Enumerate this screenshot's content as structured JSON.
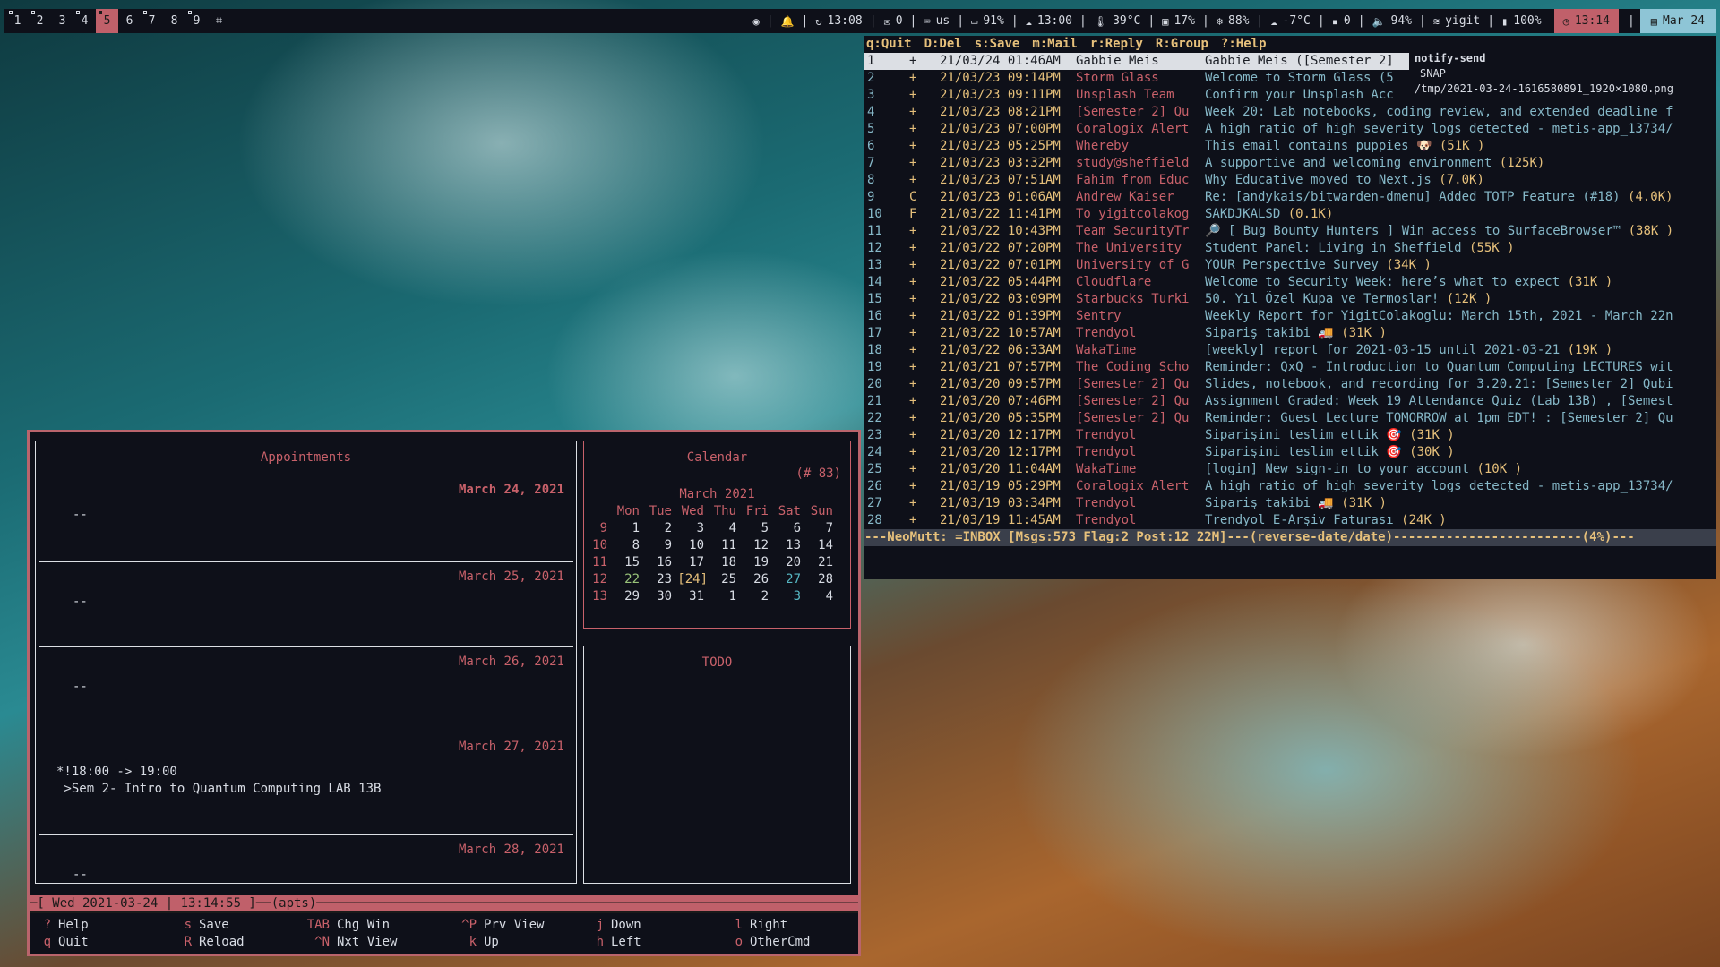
{
  "topbar": {
    "workspaces": [
      {
        "label": "1",
        "occupied": true
      },
      {
        "label": "2",
        "occupied": true
      },
      {
        "label": "3",
        "occupied": false
      },
      {
        "label": "4",
        "occupied": true
      },
      {
        "label": "5",
        "occupied": true,
        "active": true
      },
      {
        "label": "6",
        "occupied": false
      },
      {
        "label": "7",
        "occupied": true
      },
      {
        "label": "8",
        "occupied": false
      },
      {
        "label": "9",
        "occupied": true
      }
    ],
    "layout_icon": "layout-icon",
    "modules": [
      {
        "icon": "eye-icon",
        "glyph": "◉",
        "text": ""
      },
      {
        "icon": "bell-icon",
        "glyph": "🔔",
        "text": ""
      },
      {
        "icon": "refresh-icon",
        "glyph": "↻",
        "text": "13:08"
      },
      {
        "icon": "mail-icon",
        "glyph": "✉",
        "text": "0"
      },
      {
        "icon": "keyboard-icon",
        "glyph": "⌨",
        "text": "us"
      },
      {
        "icon": "laptop-icon",
        "glyph": "▭",
        "text": "91%"
      },
      {
        "icon": "cloud-upload-icon",
        "glyph": "☁",
        "text": "13:00"
      },
      {
        "icon": "thermometer-icon",
        "glyph": "🌡",
        "text": "39°C"
      },
      {
        "icon": "cpu-icon",
        "glyph": "▣",
        "text": "17%"
      },
      {
        "icon": "snowflake-icon",
        "glyph": "❄",
        "text": "88%"
      },
      {
        "icon": "weather-icon",
        "glyph": "☁",
        "text": "-7°C"
      },
      {
        "icon": "disk-icon",
        "glyph": "▪",
        "text": "0"
      },
      {
        "icon": "volume-icon",
        "glyph": "🔈",
        "text": "94%"
      },
      {
        "icon": "wifi-icon",
        "glyph": "≋",
        "text": "yigit"
      },
      {
        "icon": "battery-icon",
        "glyph": "▮",
        "text": "100%"
      }
    ],
    "clock": {
      "icon": "clock-icon",
      "glyph": "◷",
      "text": "13:14"
    },
    "date": {
      "icon": "calendar-icon",
      "glyph": "▤",
      "text": "Mar 24"
    }
  },
  "mutt": {
    "help": [
      "q:Quit",
      "D:Del",
      "s:Save",
      "m:Mail",
      "r:Reply",
      "R:Group",
      "?:Help"
    ],
    "rows": [
      {
        "n": "1",
        "f": "+",
        "d": "21/03/24 01:46AM",
        "s": "Gabbie Meis",
        "sub": "Gabbie Meis ([Semester 2]",
        "sz": ""
      },
      {
        "n": "2",
        "f": "+",
        "d": "21/03/23 09:14PM",
        "s": "Storm Glass",
        "sub": "Welcome to Storm Glass (5",
        "sz": ""
      },
      {
        "n": "3",
        "f": "+",
        "d": "21/03/23 09:11PM",
        "s": "Unsplash Team",
        "sub": "Confirm your Unsplash Acc",
        "sz": ""
      },
      {
        "n": "4",
        "f": "+",
        "d": "21/03/23 08:21PM",
        "s": "[Semester 2] Qu",
        "sub": "Week 20: Lab notebooks, coding review, and extended deadline f",
        "sz": ""
      },
      {
        "n": "5",
        "f": "+",
        "d": "21/03/23 07:00PM",
        "s": "Coralogix Alert",
        "sub": "A high ratio of high severity logs detected - metis-app_13734/",
        "sz": ""
      },
      {
        "n": "6",
        "f": "+",
        "d": "21/03/23 05:25PM",
        "s": "Whereby",
        "sub": "This email contains puppies 🐶 ",
        "sz": "(51K )"
      },
      {
        "n": "7",
        "f": "+",
        "d": "21/03/23 03:32PM",
        "s": "study@sheffield",
        "sub": "A supportive and welcoming environment ",
        "sz": "(125K)"
      },
      {
        "n": "8",
        "f": "+",
        "d": "21/03/23 07:51AM",
        "s": "Fahim from Educ",
        "sub": "Why Educative moved to Next.js ",
        "sz": "(7.0K)"
      },
      {
        "n": "9",
        "f": "C",
        "d": "21/03/23 01:06AM",
        "s": "Andrew Kaiser",
        "sub": "Re: [andykais/bitwarden-dmenu] Added TOTP Feature (#18) ",
        "sz": "(4.0K)"
      },
      {
        "n": "10",
        "f": "F",
        "d": "21/03/22 11:41PM",
        "s": "To yigitcolakog",
        "sub": "SAKDJKALSD ",
        "sz": "(0.1K)"
      },
      {
        "n": "11",
        "f": "+",
        "d": "21/03/22 10:43PM",
        "s": "Team SecurityTr",
        "sub": "🔎 [ Bug Bounty Hunters ] Win access to SurfaceBrowser™ ",
        "sz": "(38K )"
      },
      {
        "n": "12",
        "f": "+",
        "d": "21/03/22 07:20PM",
        "s": "The University",
        "sub": "Student Panel: Living in Sheffield ",
        "sz": "(55K )"
      },
      {
        "n": "13",
        "f": "+",
        "d": "21/03/22 07:01PM",
        "s": "University of G",
        "sub": "YOUR Perspective Survey ",
        "sz": "(34K )"
      },
      {
        "n": "14",
        "f": "+",
        "d": "21/03/22 05:44PM",
        "s": "Cloudflare",
        "sub": "Welcome to Security Week: here’s what to expect ",
        "sz": "(31K )"
      },
      {
        "n": "15",
        "f": "+",
        "d": "21/03/22 03:09PM",
        "s": "Starbucks Turki",
        "sub": "50. Yıl Özel Kupa ve Termoslar! ",
        "sz": "(12K )"
      },
      {
        "n": "16",
        "f": "+",
        "d": "21/03/22 01:39PM",
        "s": "Sentry",
        "sub": "Weekly Report for YigitColakoglu: March 15th, 2021 - March 22n",
        "sz": ""
      },
      {
        "n": "17",
        "f": "+",
        "d": "21/03/22 10:57AM",
        "s": "Trendyol",
        "sub": "Sipariş takibi 🚚 ",
        "sz": "(31K )"
      },
      {
        "n": "18",
        "f": "+",
        "d": "21/03/22 06:33AM",
        "s": "WakaTime",
        "sub": "[weekly] report for 2021-03-15 until 2021-03-21 ",
        "sz": "(19K )"
      },
      {
        "n": "19",
        "f": "+",
        "d": "21/03/21 07:57PM",
        "s": "The Coding Scho",
        "sub": "Reminder: QxQ - Introduction to Quantum Computing LECTURES wit",
        "sz": ""
      },
      {
        "n": "20",
        "f": "+",
        "d": "21/03/20 09:57PM",
        "s": "[Semester 2] Qu",
        "sub": "Slides, notebook, and recording for 3.20.21: [Semester 2] Qubi",
        "sz": ""
      },
      {
        "n": "21",
        "f": "+",
        "d": "21/03/20 07:46PM",
        "s": "[Semester 2] Qu",
        "sub": "Assignment Graded: Week 19 Attendance Quiz (Lab 13B) , [Semest",
        "sz": ""
      },
      {
        "n": "22",
        "f": "+",
        "d": "21/03/20 05:35PM",
        "s": "[Semester 2] Qu",
        "sub": "Reminder: Guest Lecture TOMORROW at 1pm EDT! : [Semester 2] Qu",
        "sz": ""
      },
      {
        "n": "23",
        "f": "+",
        "d": "21/03/20 12:17PM",
        "s": "Trendyol",
        "sub": "Siparişini teslim ettik 🎯 ",
        "sz": "(31K )"
      },
      {
        "n": "24",
        "f": "+",
        "d": "21/03/20 12:17PM",
        "s": "Trendyol",
        "sub": "Siparişini teslim ettik 🎯 ",
        "sz": "(30K )"
      },
      {
        "n": "25",
        "f": "+",
        "d": "21/03/20 11:04AM",
        "s": "WakaTime",
        "sub": "[login] New sign-in to your account ",
        "sz": "(10K )"
      },
      {
        "n": "26",
        "f": "+",
        "d": "21/03/19 05:29PM",
        "s": "Coralogix Alert",
        "sub": "A high ratio of high severity logs detected - metis-app_13734/",
        "sz": ""
      },
      {
        "n": "27",
        "f": "+",
        "d": "21/03/19 03:34PM",
        "s": "Trendyol",
        "sub": "Sipariş takibi 🚚 ",
        "sz": "(31K )"
      },
      {
        "n": "28",
        "f": "+",
        "d": "21/03/19 11:45AM",
        "s": "Trendyol",
        "sub": "Trendyol E-Arşiv Faturası ",
        "sz": "(24K )"
      }
    ],
    "status": "---NeoMutt: =INBOX [Msgs:573 Flag:2 Post:12 22M]---(reverse-date/date)-------------------------(4%)---"
  },
  "notification": {
    "title": "notify-send",
    "app": "SNAP",
    "body": "/tmp/2021-03-24-1616580891_1920×1080.png"
  },
  "calcurse": {
    "appointments_title": "Appointments",
    "days": [
      {
        "date": "March 24, 2021",
        "events": "--",
        "today": true
      },
      {
        "date": "March 25, 2021",
        "events": "--"
      },
      {
        "date": "March 26, 2021",
        "events": "--"
      },
      {
        "date": "March 27, 2021",
        "events": "*!18:00 -> 19:00\n >Sem 2- Intro to Quantum Computing LAB 13B"
      },
      {
        "date": "March 28, 2021",
        "events": "--"
      }
    ],
    "calendar_title": "Calendar",
    "week_badge": "(# 83)",
    "month": "March 2021",
    "weekdays": [
      "Mon",
      "Tue",
      "Wed",
      "Thu",
      "Fri",
      "Sat",
      "Sun"
    ],
    "weeks": [
      {
        "wk": "9",
        "days": [
          "1",
          "2",
          "3",
          "4",
          "5",
          "6",
          "7"
        ]
      },
      {
        "wk": "10",
        "days": [
          "8",
          "9",
          "10",
          "11",
          "12",
          "13",
          "14"
        ]
      },
      {
        "wk": "11",
        "days": [
          "15",
          "16",
          "17",
          "18",
          "19",
          "20",
          "21"
        ]
      },
      {
        "wk": "12",
        "days": [
          "22",
          "23",
          "[24]",
          "25",
          "26",
          "27",
          "28"
        ]
      },
      {
        "wk": "13",
        "days": [
          "29",
          "30",
          "31",
          "1",
          "2",
          "3",
          "4"
        ]
      }
    ],
    "highlight": {
      "12-0": "g",
      "12-2": "y",
      "12-5": "c",
      "13-5": "c"
    },
    "todo_title": "TODO",
    "status": "─[ Wed 2021-03-24 | 13:14:55 ]──(apts)────────────────────────────────────────────────────────────────────────",
    "help": [
      [
        {
          "k": "?",
          "l": "Help"
        },
        {
          "k": "q",
          "l": "Quit"
        }
      ],
      [
        {
          "k": "s",
          "l": "Save"
        },
        {
          "k": "R",
          "l": "Reload"
        }
      ],
      [
        {
          "k": "TAB",
          "l": "Chg Win"
        },
        {
          "k": "^N",
          "l": "Nxt View"
        }
      ],
      [
        {
          "k": "^P",
          "l": "Prv View"
        },
        {
          "k": "k",
          "l": "Up"
        }
      ],
      [
        {
          "k": "j",
          "l": "Down"
        },
        {
          "k": "h",
          "l": "Left"
        }
      ],
      [
        {
          "k": "l",
          "l": "Right"
        },
        {
          "k": "o",
          "l": "OtherCmd"
        }
      ]
    ]
  }
}
